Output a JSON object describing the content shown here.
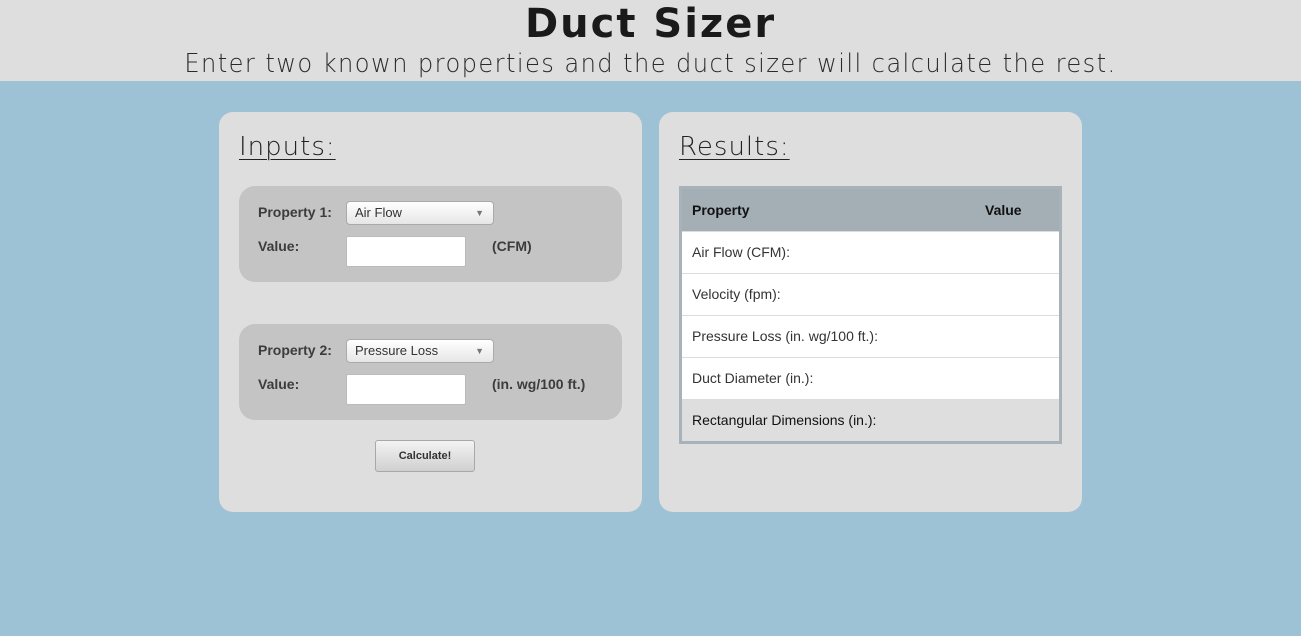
{
  "header": {
    "title": "Duct Sizer",
    "subtitle": "Enter two known properties and the duct sizer will calculate the rest."
  },
  "inputs": {
    "heading": "Inputs:",
    "property1": {
      "label": "Property 1:",
      "selected": "Air Flow",
      "value_label": "Value:",
      "value": "",
      "unit": "(CFM)"
    },
    "property2": {
      "label": "Property 2:",
      "selected": "Pressure Loss",
      "value_label": "Value:",
      "value": "",
      "unit": "(in. wg/100 ft.)"
    },
    "calculate_label": "Calculate!"
  },
  "results": {
    "heading": "Results:",
    "columns": [
      "Property",
      "Value"
    ],
    "rows": [
      {
        "property": "Air Flow (CFM):",
        "value": ""
      },
      {
        "property": "Velocity (fpm):",
        "value": ""
      },
      {
        "property": "Pressure Loss (in. wg/100 ft.):",
        "value": ""
      },
      {
        "property": "Duct Diameter (in.):",
        "value": ""
      },
      {
        "property": "Rectangular Dimensions (in.):",
        "value": ""
      }
    ]
  },
  "colors": {
    "page_background": "#9ec2d5",
    "panel_background": "#dedede",
    "property_box": "#c4c4c4",
    "table_header": "#a4aeb5"
  }
}
